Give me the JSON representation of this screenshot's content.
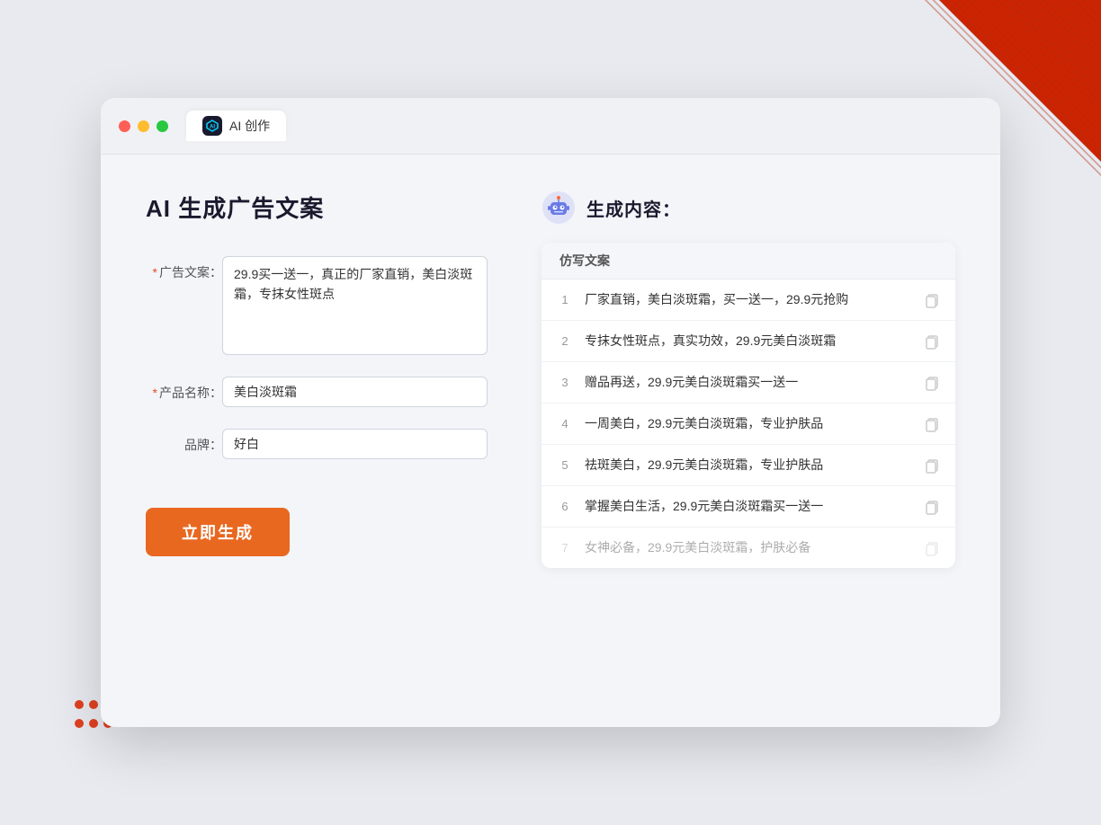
{
  "browser": {
    "tab_label": "AI 创作",
    "tab_icon": "AI"
  },
  "window_controls": {
    "dot_red": "close",
    "dot_yellow": "minimize",
    "dot_green": "maximize"
  },
  "left_panel": {
    "title": "AI 生成广告文案",
    "fields": {
      "ad_copy": {
        "label": "广告文案：",
        "required": true,
        "required_star": "*",
        "value": "29.9买一送一，真正的厂家直销，美白淡斑霜，专抹女性斑点"
      },
      "product_name": {
        "label": "产品名称：",
        "required": true,
        "required_star": "*",
        "value": "美白淡斑霜"
      },
      "brand": {
        "label": "品牌：",
        "required": false,
        "required_star": "",
        "value": "好白"
      }
    },
    "generate_button": "立即生成"
  },
  "right_panel": {
    "title": "生成内容：",
    "column_header": "仿写文案",
    "results": [
      {
        "id": 1,
        "text": "厂家直销，美白淡斑霜，买一送一，29.9元抢购",
        "faded": false
      },
      {
        "id": 2,
        "text": "专抹女性斑点，真实功效，29.9元美白淡斑霜",
        "faded": false
      },
      {
        "id": 3,
        "text": "赠品再送，29.9元美白淡斑霜买一送一",
        "faded": false
      },
      {
        "id": 4,
        "text": "一周美白，29.9元美白淡斑霜，专业护肤品",
        "faded": false
      },
      {
        "id": 5,
        "text": "祛斑美白，29.9元美白淡斑霜，专业护肤品",
        "faded": false
      },
      {
        "id": 6,
        "text": "掌握美白生活，29.9元美白淡斑霜买一送一",
        "faded": false
      },
      {
        "id": 7,
        "text": "女神必备，29.9元美白淡斑霜，护肤必备",
        "faded": true
      }
    ]
  },
  "colors": {
    "accent_orange": "#e86820",
    "accent_blue": "#6a7be8",
    "required_red": "#e05020",
    "text_dark": "#1a1a2e",
    "text_muted": "#999"
  }
}
